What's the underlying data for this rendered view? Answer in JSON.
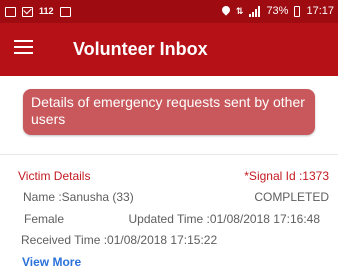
{
  "status_bar": {
    "left_number": "112",
    "battery": "73%",
    "time": "17:17"
  },
  "app_bar": {
    "title": "Volunteer Inbox"
  },
  "notice": {
    "text": "Details of emergency requests sent by other users"
  },
  "card": {
    "header": "Victim Details",
    "signal_id": "*Signal Id :1373",
    "name": "Name :Sanusha (33)",
    "status": "COMPLETED",
    "gender": "Female",
    "updated_time": "Updated Time :01/08/2018 17:16:48",
    "received_time": "Received Time :01/08/2018 17:15:22",
    "view_more": "View More"
  }
}
